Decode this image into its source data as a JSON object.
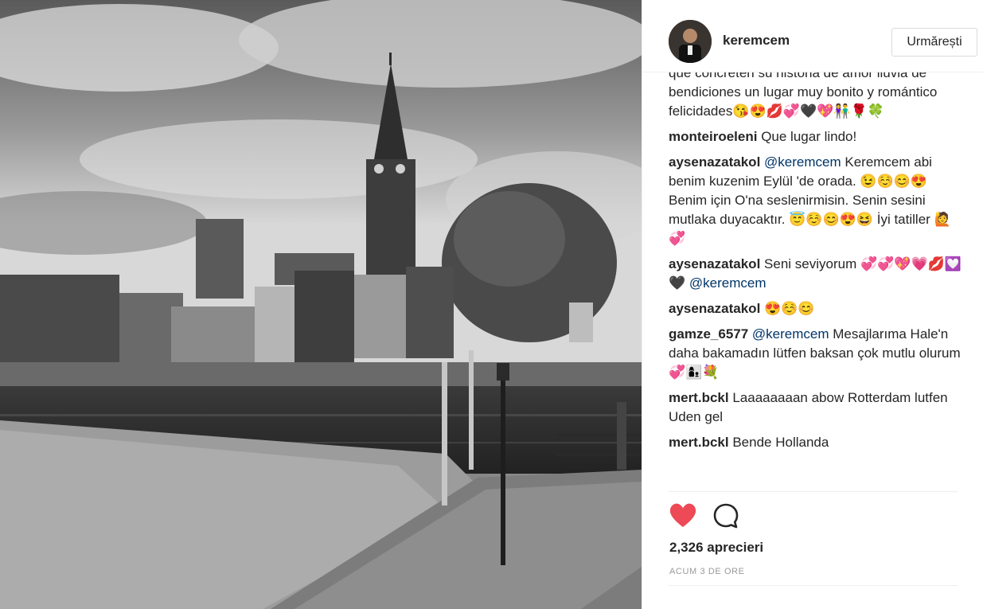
{
  "post": {
    "author": "keremcem",
    "follow_label": "Urmărești",
    "likes": "2,326 aprecieri",
    "time": "ACUM 3 DE ORE"
  },
  "comments": [
    {
      "user": "",
      "text": "que concreten su historia de amor lluvia de bendiciones un lugar muy bonito y romántico felicidades😘😍💋💞🖤💖👫🌹🍀"
    },
    {
      "user": "monteiroeleni",
      "text": "Que lugar lindo!"
    },
    {
      "user": "aysenazatakol",
      "mention": "@keremcem",
      "text": " Keremcem abi benim kuzenim Eylül 'de orada. 😉☺️😊😍 Benim için O'na seslenirmisin. Senin sesini mutlaka duyacaktır. 😇☺️😊😍😆 İyi tatiller 🙋💞"
    },
    {
      "user": "aysenazatakol",
      "text": "Seni seviyorum 💞💞💖💗💋💟🖤 ",
      "mention_after": "@keremcem"
    },
    {
      "user": "aysenazatakol",
      "text": "😍☺️😊"
    },
    {
      "user": "gamze_6577",
      "mention": "@keremcem",
      "text": " Mesajlarıma Hale'n daha bakamadın lütfen baksan çok mutlu olurum 💞👩‍👦💐"
    },
    {
      "user": "mert.bckl",
      "text": "Laaaaaaaan abow Rotterdam lutfen Uden gel"
    },
    {
      "user": "mert.bckl",
      "text": "Bende Hollanda"
    }
  ],
  "icons": {
    "like": "heart-icon",
    "comment": "comment-bubble-icon"
  },
  "colors": {
    "heart": "#ed4956",
    "mention": "#003569"
  }
}
